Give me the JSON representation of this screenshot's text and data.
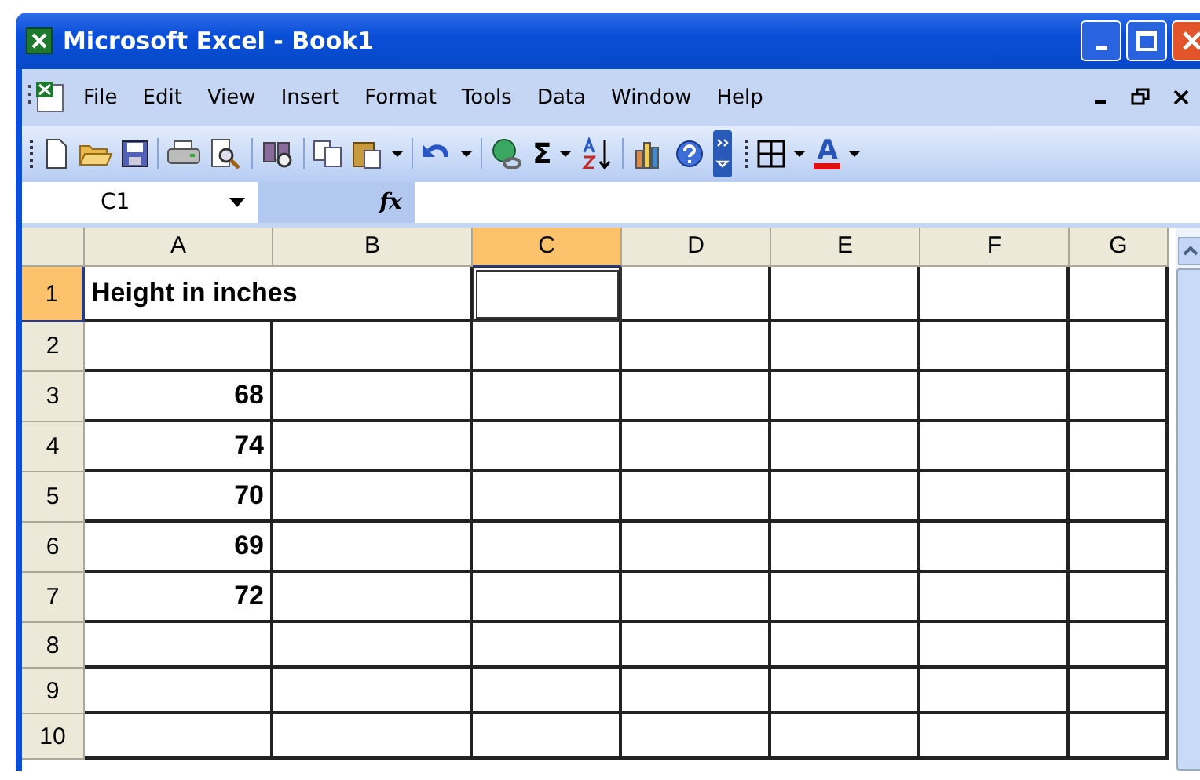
{
  "window": {
    "title": "Microsoft Excel - Book1"
  },
  "menu": [
    "File",
    "Edit",
    "View",
    "Insert",
    "Format",
    "Tools",
    "Data",
    "Window",
    "Help"
  ],
  "toolbar": [
    {
      "kind": "grip"
    },
    {
      "kind": "new"
    },
    {
      "kind": "open"
    },
    {
      "kind": "save"
    },
    {
      "kind": "sep"
    },
    {
      "kind": "print"
    },
    {
      "kind": "preview"
    },
    {
      "kind": "sep"
    },
    {
      "kind": "research"
    },
    {
      "kind": "sep"
    },
    {
      "kind": "copy"
    },
    {
      "kind": "paste"
    },
    {
      "kind": "caret"
    },
    {
      "kind": "sep"
    },
    {
      "kind": "undo"
    },
    {
      "kind": "caret"
    },
    {
      "kind": "sep"
    },
    {
      "kind": "link"
    },
    {
      "kind": "glyph",
      "text": "Σ"
    },
    {
      "kind": "caret"
    },
    {
      "kind": "sort"
    },
    {
      "kind": "sep"
    },
    {
      "kind": "chart"
    },
    {
      "kind": "help"
    },
    {
      "kind": "more"
    },
    {
      "kind": "grip"
    },
    {
      "kind": "borders"
    },
    {
      "kind": "caret"
    },
    {
      "kind": "fontcolor",
      "text": "A"
    },
    {
      "kind": "caret"
    }
  ],
  "formula_bar": {
    "name_box": "C1",
    "fx": "fx"
  },
  "columns": [
    {
      "label": "A",
      "selected": false
    },
    {
      "label": "B",
      "selected": false
    },
    {
      "label": "C",
      "selected": true
    },
    {
      "label": "D",
      "selected": false
    },
    {
      "label": "E",
      "selected": false
    },
    {
      "label": "F",
      "selected": false
    },
    {
      "label": "G",
      "selected": false
    }
  ],
  "rows": [
    {
      "label": "1",
      "selected": true,
      "cells": [
        {
          "kind": "text",
          "text": "Height in inches"
        }
      ]
    },
    {
      "label": "2",
      "selected": false
    },
    {
      "label": "3",
      "selected": false,
      "cells": [
        {
          "kind": "number",
          "text": "68"
        }
      ]
    },
    {
      "label": "4",
      "selected": false,
      "cells": [
        {
          "kind": "number",
          "text": "74"
        }
      ]
    },
    {
      "label": "5",
      "selected": false,
      "cells": [
        {
          "kind": "number",
          "text": "70"
        }
      ]
    },
    {
      "label": "6",
      "selected": false,
      "cells": [
        {
          "kind": "number",
          "text": "69"
        }
      ]
    },
    {
      "label": "7",
      "selected": false,
      "cells": [
        {
          "kind": "number",
          "text": "72"
        }
      ]
    },
    {
      "label": "8",
      "selected": false
    },
    {
      "label": "9",
      "selected": false
    },
    {
      "label": "10",
      "selected": false
    }
  ]
}
